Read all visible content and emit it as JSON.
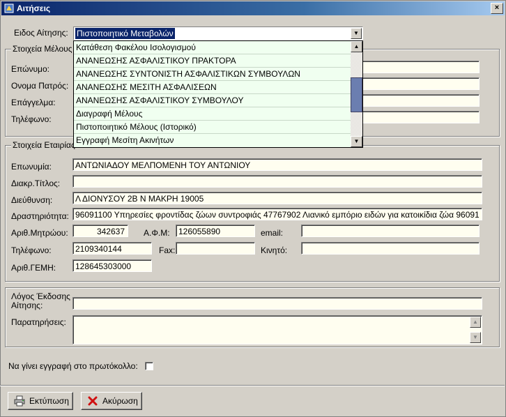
{
  "window": {
    "title": "Αιτήσεις",
    "close_glyph": "×"
  },
  "request_type": {
    "label": "Ειδος Αίτησης:",
    "selected": "Πιστοποιητικό Μεταβολών",
    "options": [
      "Κατάθεση Φακέλου Ισολογισμού",
      "ΑΝΑΝΕΩΣΗΣ ΑΣΦΑΛΙΣΤΙΚΟΥ ΠΡΑΚΤΟΡΑ",
      "ΑΝΑΝΕΩΣΗΣ ΣΥΝΤΟΝΙΣΤΗ ΑΣΦΑΛΙΣΤΙΚΩΝ ΣΥΜΒΟΥΛΩΝ",
      "ΑΝΑΝΕΩΣΗΣ ΜΕΣΙΤΗ ΑΣΦΑΛΙΣΕΩΝ",
      "ΑΝΑΝΕΩΣΗΣ ΑΣΦΑΛΙΣΤΙΚΟΥ ΣΥΜΒΟΥΛΟΥ",
      "Διαγραφή Μέλους",
      "Πιστοποιητικό Μέλους (Ιστορικό)",
      "Εγγραφή Μεσίτη Ακινήτων"
    ],
    "scroll_up": "▲",
    "scroll_down": "▼"
  },
  "member": {
    "title": "Στοιχεία Μέλους",
    "surname_label": "Επώνυμο:",
    "father_label": "Ονομα Πατρός:",
    "profession_label": "Επάγγελμα:",
    "phone_label": "Τηλέφωνο:"
  },
  "company": {
    "title": "Στοιχεία Εταιρίας",
    "name_label": "Επωνυμία:",
    "name": "ΑΝΤΩΝΙΑΔΟΥ ΜΕΛΠΟΜΕΝΗ ΤΟΥ ΑΝΤΩΝΙΟΥ",
    "distinct_label": "Διακρ.Τίτλος:",
    "distinct": "",
    "address_label": "Διεύθυνση:",
    "address": "Λ ΔΙΟΝΥΣΟΥ 2Β Ν ΜΑΚΡΗ 19005",
    "activity_label": "Δραστηριότητα:",
    "activity": "96091100 Υπηρεσίες φροντίδας ζώων συντροφιάς 47767902 Λιανικό εμπόριο ειδών για κατοικίδια ζώα 96091",
    "registry_label": "Αριθ.Μητρώου:",
    "registry": "342637",
    "afm_label": "Α.Φ.Μ:",
    "afm": "126055890",
    "email_label": "email:",
    "email": "",
    "phone_label": "Τηλέφωνο:",
    "phone": "2109340144",
    "fax_label": "Fax:",
    "fax": "",
    "mobile_label": "Κινητό:",
    "mobile": "",
    "gemi_label": "Αριθ.ΓΕΜΗ:",
    "gemi": "128645303000"
  },
  "reason": {
    "label_line1": "Λόγος Έκδοσης",
    "label_line2": "Αίτησης:",
    "value": "",
    "notes_label": "Παρατηρήσεις:",
    "notes": ""
  },
  "protocol": {
    "label": "Να γίνει εγγραφή στο πρωτόκολλο:"
  },
  "buttons": {
    "print": "Εκτύπωση",
    "cancel": "Ακύρωση"
  },
  "colors": {
    "title_start": "#0a246a",
    "title_end": "#a6caf0",
    "field_bg": "#fffef0",
    "dropdown_bg": "#f0fff0",
    "selection": "#0a246a"
  }
}
